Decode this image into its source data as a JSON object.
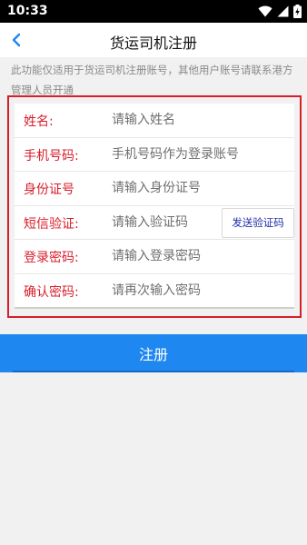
{
  "status_bar": {
    "time": "10:33"
  },
  "header": {
    "title": "货运司机注册"
  },
  "notice": "此功能仅适用于货运司机注册账号，其他用户账号请联系港方管理人员开通",
  "form": {
    "rows": [
      {
        "label": "姓名:",
        "placeholder": "请输入姓名"
      },
      {
        "label": "手机号码:",
        "placeholder": "手机号码作为登录账号"
      },
      {
        "label": "身份证号",
        "placeholder": "请输入身份证号"
      },
      {
        "label": "短信验证:",
        "placeholder": "请输入验证码"
      },
      {
        "label": "登录密码:",
        "placeholder": "请输入登录密码"
      },
      {
        "label": "确认密码:",
        "placeholder": "请再次输入密码"
      }
    ],
    "send_code_label": "发送验证码"
  },
  "register_label": "注册",
  "colors": {
    "accent": "#1e87f0",
    "highlight": "#d81e2a",
    "label": "#d81e2a",
    "link": "#1f2fa8"
  }
}
